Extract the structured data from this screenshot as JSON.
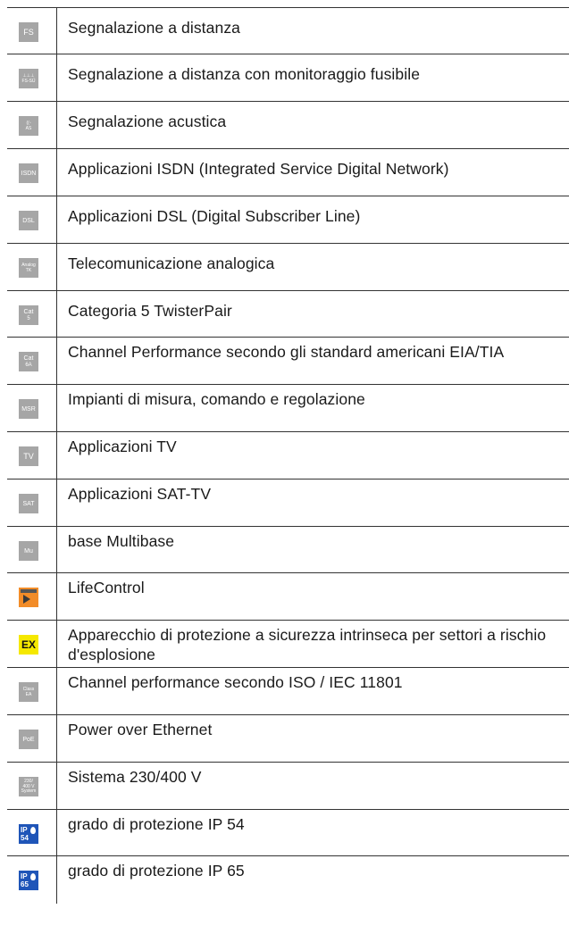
{
  "rows": [
    {
      "icon": "fs-icon",
      "icon_text": [
        "FS",
        ""
      ],
      "text": "Segnalazione a distanza"
    },
    {
      "icon": "fs-su-icon",
      "icon_text": [
        "⊥⊥⊥",
        "FS-SÜ"
      ],
      "text": "Segnalazione a distanza con monitoraggio fusibile"
    },
    {
      "icon": "as-icon",
      "icon_text": [
        "((▫",
        "AS"
      ],
      "text": "Segnalazione acustica"
    },
    {
      "icon": "isdn-icon",
      "icon_text": [
        "ISDN",
        ""
      ],
      "text": "Applicazioni ISDN (Integrated Service Digital Network)"
    },
    {
      "icon": "dsl-icon",
      "icon_text": [
        "DSL",
        ""
      ],
      "text": "Applicazioni DSL (Digital Subscriber Line)"
    },
    {
      "icon": "analog-tk-icon",
      "icon_text": [
        "Analog",
        "TK"
      ],
      "text": "Telecomunicazione analogica"
    },
    {
      "icon": "cat5-icon",
      "icon_text": [
        "Cat",
        "5"
      ],
      "text": "Categoria 5 TwisterPair"
    },
    {
      "icon": "cat6a-icon",
      "icon_text": [
        "Cat",
        "6A"
      ],
      "text": "Channel Performance secondo gli standard americani EIA/TIA"
    },
    {
      "icon": "msr-icon",
      "icon_text": [
        "MSR",
        ""
      ],
      "text": "Impianti di misura, comando e regolazione"
    },
    {
      "icon": "tv-icon",
      "icon_text": [
        "TV",
        ""
      ],
      "text": "Applicazioni TV"
    },
    {
      "icon": "sat-icon",
      "icon_text": [
        "SAT",
        ""
      ],
      "text": "Applicazioni SAT-TV"
    },
    {
      "icon": "mu-icon",
      "icon_text": [
        "Mu",
        ""
      ],
      "text": "base Multibase"
    },
    {
      "icon": "lifecontrol-icon",
      "icon_text": [
        "Life Control",
        ""
      ],
      "text": "LifeControl"
    },
    {
      "icon": "ex-icon",
      "icon_text": [
        "EX",
        ""
      ],
      "text": "Apparecchio di protezione a sicurezza intrinseca per settori a rischio d'esplosione"
    },
    {
      "icon": "class-ea-icon",
      "icon_text": [
        "Class",
        "EA"
      ],
      "text": "Channel performance secondo ISO / IEC 11801"
    },
    {
      "icon": "poe-icon",
      "icon_text": [
        "PoE",
        ""
      ],
      "text": "Power over Ethernet"
    },
    {
      "icon": "system-230-400-icon",
      "icon_text": [
        "230/",
        "400 V System"
      ],
      "text": "Sistema 230/400 V"
    },
    {
      "icon": "ip54-icon",
      "icon_text": [
        "IP",
        "54"
      ],
      "text": "grado di protezione IP 54"
    },
    {
      "icon": "ip65-icon",
      "icon_text": [
        "IP",
        "65"
      ],
      "text": "grado di protezione IP 65"
    }
  ],
  "colors": {
    "icon_gray": "#a6a6a6",
    "ex_yellow": "#f5e800",
    "ip_blue": "#1f55b8",
    "lifecontrol_orange": "#f28c28",
    "rule": "#333333"
  }
}
